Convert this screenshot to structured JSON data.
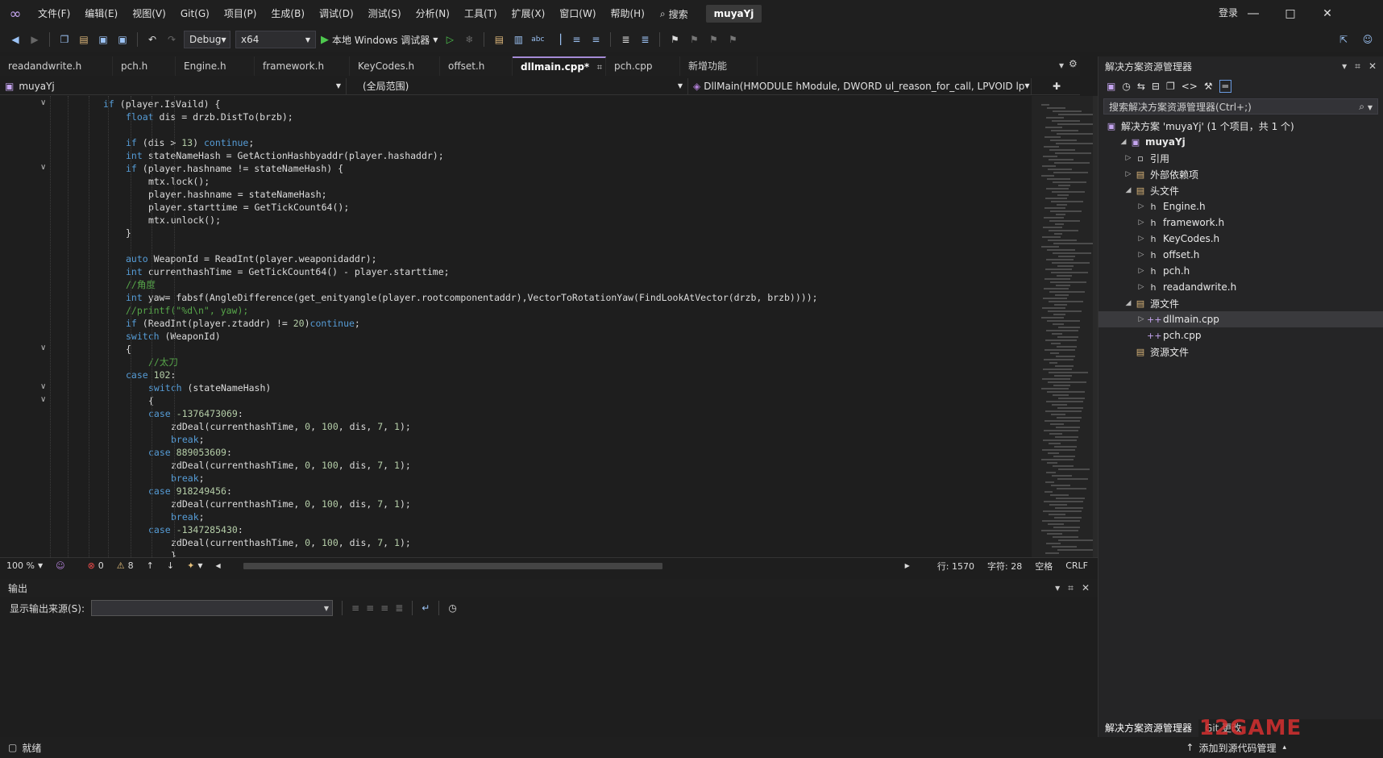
{
  "menu": [
    "文件(F)",
    "编辑(E)",
    "视图(V)",
    "Git(G)",
    "项目(P)",
    "生成(B)",
    "调试(D)",
    "测试(S)",
    "分析(N)",
    "工具(T)",
    "扩展(X)",
    "窗口(W)",
    "帮助(H)"
  ],
  "search_label": "搜索",
  "solution_name": "muyaYj",
  "login_label": "登录",
  "toolbar": {
    "config": "Debug",
    "platform": "x64",
    "run_label": "本地 Windows 调试器"
  },
  "doc_tabs": [
    "readandwrite.h",
    "pch.h",
    "Engine.h",
    "framework.h",
    "KeyCodes.h",
    "offset.h",
    "dllmain.cpp*",
    "pch.cpp",
    "新增功能"
  ],
  "active_tab_index": 6,
  "navbar": {
    "project": "muyaYj",
    "scope": "(全局范围)",
    "function": "DllMain(HMODULE hModule, DWORD ul_reason_for_call, LPVOID lp"
  },
  "code_lines": [
    "if (player.IsVaild) {",
    "float dis = drzb.DistTo(brzb);",
    "",
    "if (dis > 13) continue;",
    "int stateNameHash = GetActionHashbyaddr(player.hashaddr);",
    "if (player.hashname != stateNameHash) {",
    "mtx.lock();",
    "player.hashname = stateNameHash;",
    "player.starttime = GetTickCount64();",
    "mtx.unlock();",
    "}",
    "",
    "auto WeaponId = ReadInt(player.weaponidaddr);",
    "int currenthashTime = GetTickCount64() - player.starttime;",
    "//角度",
    "int yaw= fabsf(AngleDifference(get_enityangle(player.rootcomponentaddr),VectorToRotationYaw(FindLookAtVector(drzb, brzb))));",
    "//printf(\"%d\\n\", yaw);",
    "if (ReadInt(player.ztaddr) != 20)continue;",
    "switch (WeaponId)",
    "{",
    "//太刀",
    "case 102:",
    "switch (stateNameHash)",
    "{",
    "case -1376473069:",
    "zdDeal(currenthashTime, 0, 100, dis, 7, 1);",
    "break;",
    "case 889053609:",
    "zdDeal(currenthashTime, 0, 100, dis, 7, 1);",
    "break;",
    "case 918249456:",
    "zdDeal(currenthashTime, 0, 100, dis, 7, 1);",
    "break;",
    "case -1347285430:",
    "zdDeal(currenthashTime, 0, 100, dis, 7, 1);",
    "}"
  ],
  "editor_status": {
    "zoom": "100 %",
    "errors": "0",
    "warnings": "8",
    "line": "行: 1570",
    "col": "字符: 28",
    "whitespace": "空格",
    "eol": "CRLF"
  },
  "output": {
    "title": "输出",
    "source_label": "显示输出来源(S):"
  },
  "solution_explorer": {
    "title": "解决方案资源管理器",
    "search_placeholder": "搜索解决方案资源管理器(Ctrl+;)",
    "solution_label": "解决方案 'muyaYj' (1 个项目，共 1 个)",
    "project": "muyaYj",
    "references": "引用",
    "external_deps": "外部依赖项",
    "headers_folder": "头文件",
    "headers": [
      "Engine.h",
      "framework.h",
      "KeyCodes.h",
      "offset.h",
      "pch.h",
      "readandwrite.h"
    ],
    "source_folder": "源文件",
    "sources": [
      "dllmain.cpp",
      "pch.cpp"
    ],
    "resources_folder": "资源文件",
    "bottom_tabs": [
      "解决方案资源管理器",
      "Git 更改"
    ]
  },
  "statusbar": {
    "ready": "就绪",
    "add_source": "添加到源代码管理"
  },
  "watermark": "12GAME"
}
